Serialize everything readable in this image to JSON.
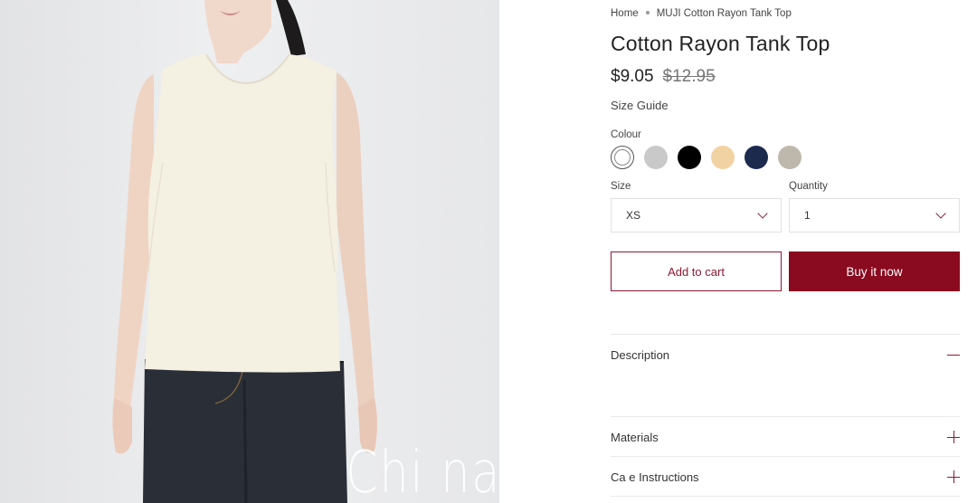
{
  "breadcrumb": {
    "home": "Home",
    "current": "MUJI Cotton Rayon Tank Top"
  },
  "product": {
    "title": "Cotton Rayon Tank Top",
    "price": "$9.05",
    "compare_price": "$12.95",
    "size_guide": "Size Guide"
  },
  "colour": {
    "label": "Colour",
    "swatches": [
      "#ffffff",
      "#c9c9c9",
      "#000000",
      "#f1d3a3",
      "#1c2a4d",
      "#bdb8ab"
    ],
    "selected_index": 0
  },
  "size": {
    "label": "Size",
    "value": "XS"
  },
  "quantity": {
    "label": "Quantity",
    "value": "1"
  },
  "actions": {
    "add_to_cart": "Add to cart",
    "buy_now": "Buy it now"
  },
  "accordion": [
    {
      "label": "Description",
      "state": "expanded"
    },
    {
      "label": "Materials",
      "state": "collapsed"
    },
    {
      "label": "Ca e Instructions",
      "state": "collapsed"
    }
  ],
  "watermark": "Chi na",
  "colors": {
    "accent": "#8a0a1f",
    "accent_outline": "#8d1932"
  },
  "icons": {
    "dropdown": "chevron-down-icon",
    "collapse": "minus-icon",
    "expand": "plus-icon"
  }
}
